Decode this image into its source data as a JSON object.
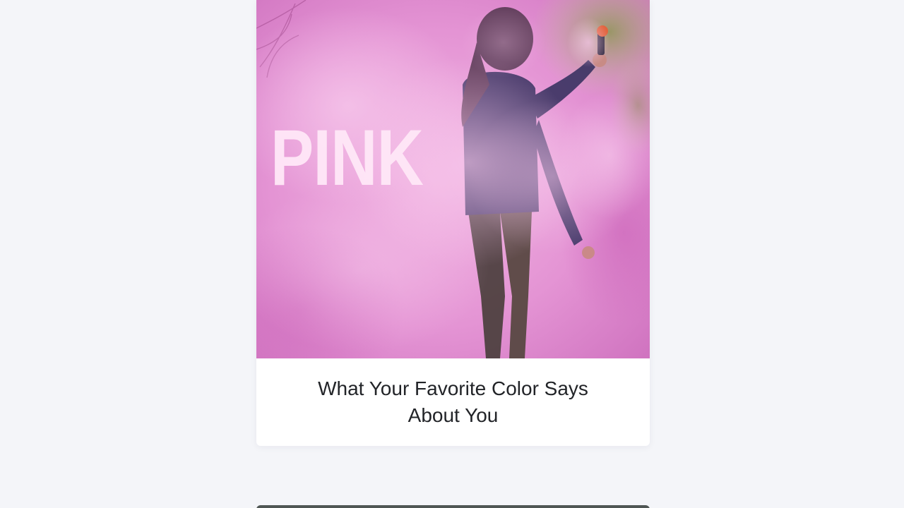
{
  "feed": {
    "articles": [
      {
        "image_word": "PINK",
        "title": "What Your Favorite Color Says About You"
      }
    ]
  },
  "colors": {
    "page_background": "#f4f5f9",
    "card_background": "#ffffff",
    "title_text": "#222428",
    "smoke_pink": "#e79ad6"
  }
}
